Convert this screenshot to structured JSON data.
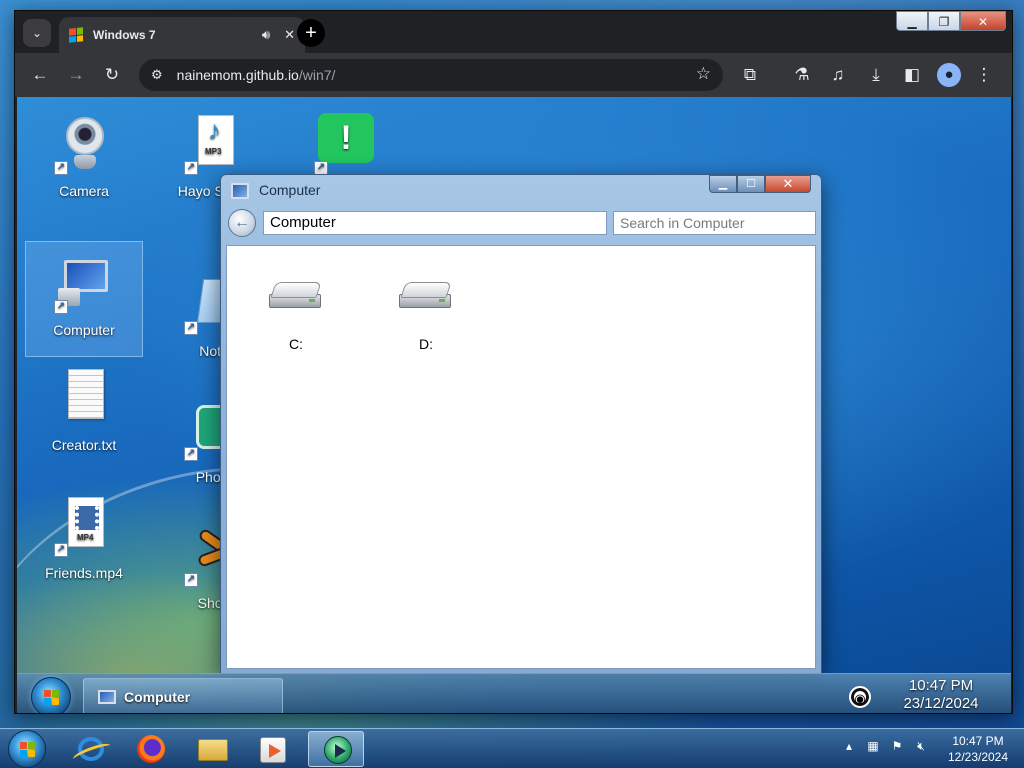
{
  "browser": {
    "tab_title": "Windows 7",
    "url_host": "nainemom.github.io",
    "url_path": "/win7/"
  },
  "desktop": {
    "icons": [
      {
        "label": "Camera"
      },
      {
        "label": "Computer"
      },
      {
        "label": "Creator.txt"
      },
      {
        "label": "Friends.mp4"
      },
      {
        "label": "Hayo Saghi"
      },
      {
        "label": "Note"
      },
      {
        "label": "Photo"
      },
      {
        "label": "Shoo"
      }
    ]
  },
  "explorer": {
    "title": "Computer",
    "address": "Computer",
    "search_placeholder": "Search in Computer",
    "drives": [
      {
        "label": "C:"
      },
      {
        "label": "D:"
      }
    ]
  },
  "page_taskbar": {
    "active_item": "Computer",
    "time": "10:47 PM",
    "date": "23/12/2024"
  },
  "host_taskbar": {
    "time": "10:47 PM",
    "date": "12/23/2024"
  },
  "icons": {
    "back": "arrow-left-icon",
    "forward": "arrow-right-icon",
    "reload": "reload-icon",
    "site_info": "site-info-icon",
    "bookmark": "star-icon",
    "extensions": "puzzle-icon",
    "labs": "flask-icon",
    "media": "media-control-icon",
    "downloads": "download-icon",
    "side_panel": "side-panel-icon",
    "profile": "profile-icon",
    "menu": "kebab-menu-icon"
  },
  "colors": {
    "chrome_dark": "#202124",
    "chrome_toolbar": "#35363a",
    "explorer_frame": "#a8c7e6",
    "close_red": "#c8472c"
  }
}
